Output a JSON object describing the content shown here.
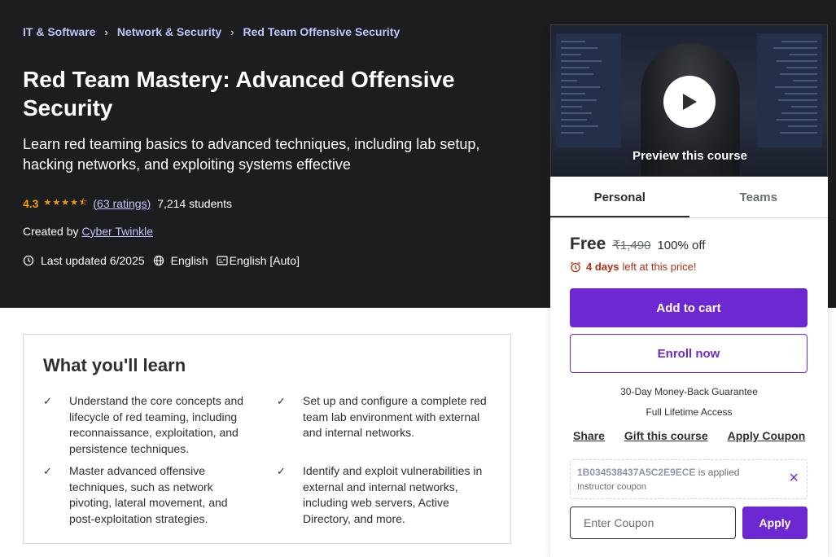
{
  "breadcrumb": [
    "IT & Software",
    "Network & Security",
    "Red Team Offensive Security"
  ],
  "course": {
    "title": "Red Team Mastery: Advanced Offensive Security",
    "subtitle": "Learn red teaming basics to advanced techniques, including lab setup, hacking networks, and exploiting systems effective",
    "rating": "4.3",
    "stars": 4.3,
    "ratings_count": "(63 ratings)",
    "students": "7,214 students",
    "created_by_label": "Created by",
    "instructor": "Cyber Twinkle",
    "last_updated": "Last updated 6/2025",
    "language": "English",
    "captions": "English [Auto]"
  },
  "learn": {
    "title": "What you'll learn",
    "items": [
      "Understand the core concepts and lifecycle of red teaming, including reconnaissance, exploitation, and persistence techniques.",
      "Set up and configure a complete red team lab environment with external and internal networks.",
      "Master advanced offensive techniques, such as network pivoting, lateral movement, and post-exploitation strategies.",
      "Identify and exploit vulnerabilities in external and internal networks, including web servers, Active Directory, and more."
    ]
  },
  "sidebar": {
    "preview_label": "Preview this course",
    "tabs": [
      "Personal",
      "Teams"
    ],
    "active_tab": "Personal",
    "price": "Free",
    "original_price": "₹1,490",
    "discount": "100% off",
    "timer_bold": "4 days",
    "timer_text": "left at this price!",
    "add_to_cart": "Add to cart",
    "enroll_now": "Enroll now",
    "guarantee": "30-Day Money-Back Guarantee",
    "lifetime": "Full Lifetime Access",
    "links": [
      "Share",
      "Gift this course",
      "Apply Coupon"
    ],
    "coupon_code": "1B034538437A5C2E9ECE",
    "coupon_status": "is applied",
    "coupon_type": "Instructor coupon",
    "coupon_placeholder": "Enter Coupon",
    "apply_label": "Apply"
  },
  "colors": {
    "hero_bg": "#1c1d1f",
    "breadcrumb_link": "#c0c4fc",
    "star": "#f69c08",
    "primary": "#6d28d2",
    "timer": "#b32d0f"
  },
  "icons": [
    "chevron-right-icon",
    "star-icon",
    "clock-icon",
    "globe-icon",
    "captions-icon",
    "play-icon",
    "alarm-icon",
    "check-icon",
    "close-icon"
  ]
}
